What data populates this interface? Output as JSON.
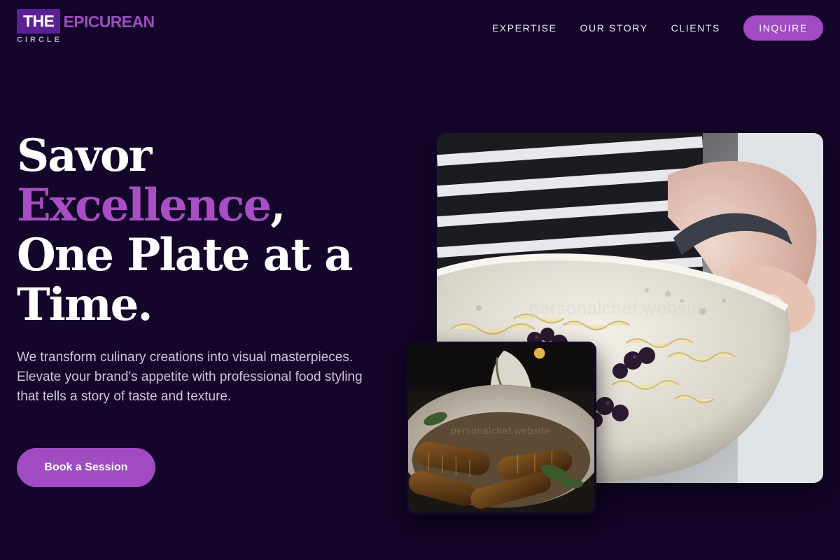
{
  "brand": {
    "the": "THE",
    "name": "EPICUREAN",
    "tagline": "CIRCLE"
  },
  "nav": {
    "links": [
      "EXPERTISE",
      "OUR STORY",
      "CLIENTS"
    ],
    "cta": "INQUIRE"
  },
  "hero": {
    "line1": "Savor",
    "accent": "Excellence",
    "comma": ",",
    "line3": "One Plate at a",
    "line4": "Time.",
    "description": "We transform culinary creations into visual masterpieces. Elevate your brand's appetite with professional food styling that tells a story of taste and texture.",
    "button": "Book a Session"
  },
  "images": {
    "main_watermark": "personalchef.website",
    "small_watermark": "personalchef.website"
  },
  "colors": {
    "background": "#14052a",
    "accent": "#a04bc2",
    "logo_box": "#5a2196"
  }
}
